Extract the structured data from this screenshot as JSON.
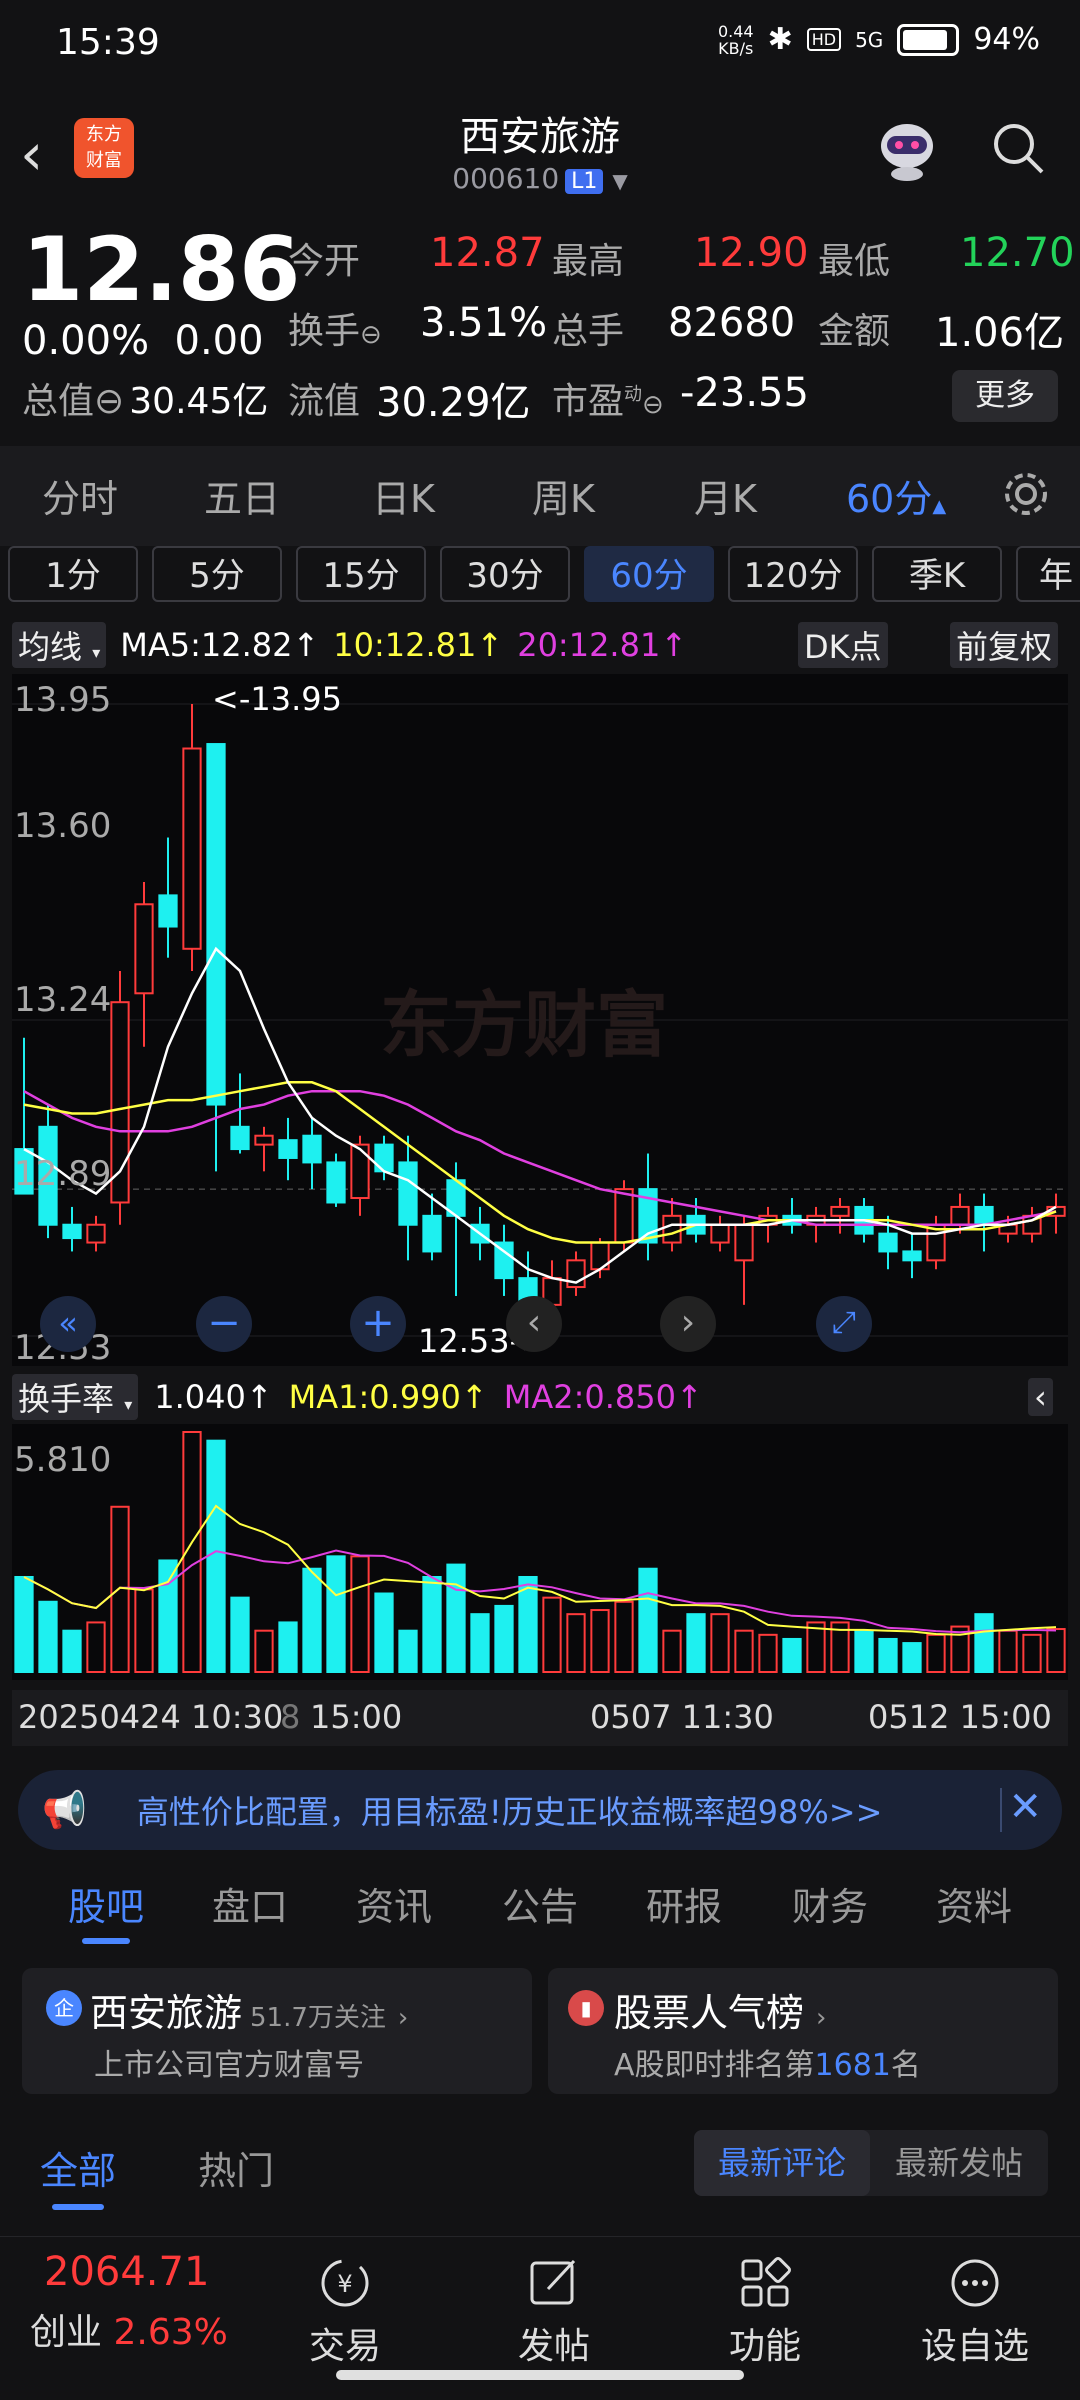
{
  "status_bar": {
    "time": "15:39",
    "net_speed_top": "0.44",
    "net_speed_unit": "KB/s",
    "hd": "HD",
    "net": "5G",
    "battery": "94%"
  },
  "header": {
    "logo_line1": "东方",
    "logo_line2": "财富",
    "stock_name": "西安旅游",
    "stock_code": "000610",
    "level": "L1"
  },
  "quote": {
    "price": "12.86",
    "change_pct": "0.00%",
    "change": "0.00",
    "open_label": "今开",
    "open": "12.87",
    "high_label": "最高",
    "high": "12.90",
    "low_label": "最低",
    "low": "12.70",
    "turnover_label": "换手",
    "turnover": "3.51%",
    "volume_label": "总手",
    "volume": "82680",
    "amount_label": "金额",
    "amount": "1.06亿",
    "mktcap_label": "总值",
    "mktcap": "30.45亿",
    "float_label": "流值",
    "float_cap": "30.29亿",
    "pe_label": "市盈",
    "pe_sup": "动",
    "pe": "-23.55",
    "more": "更多"
  },
  "period_tabs": [
    "分时",
    "五日",
    "日K",
    "周K",
    "月K",
    "60分"
  ],
  "sub_periods": [
    "1分",
    "5分",
    "15分",
    "30分",
    "60分",
    "120分",
    "季K",
    "年"
  ],
  "ma_bar": {
    "label": "均线",
    "ma5": "MA5:12.82↑",
    "ma10": "10:12.81↑",
    "ma20": "20:12.81↑",
    "dk": "DK点",
    "fq": "前复权"
  },
  "price_axis": [
    "13.95",
    "13.60",
    "13.24",
    "12.89",
    "12.53"
  ],
  "annotations": {
    "high": "<-13.95",
    "low": "12.53->",
    "watermark": "东方财富"
  },
  "ind_bar": {
    "label": "换手率",
    "v": "1.040↑",
    "ma1": "MA1:0.990↑",
    "ma2": "MA2:0.850↑",
    "axis_max": "5.810"
  },
  "time_axis": [
    "20250424 10:30",
    "8",
    "15:00",
    "0507 11:30",
    "0512 15:00"
  ],
  "colors": {
    "up": "#ff3b3b",
    "down": "#1ef0f0",
    "ma5": "#ffffff",
    "ma10": "#ffff44",
    "ma20": "#e040e0",
    "accent": "#4a86ff"
  },
  "chart_data": {
    "type": "candlestick",
    "ylim": [
      12.53,
      13.95
    ],
    "candles": [
      {
        "o": 12.95,
        "h": 13.2,
        "l": 12.85,
        "c": 12.85
      },
      {
        "o": 13.0,
        "h": 13.05,
        "l": 12.75,
        "c": 12.78
      },
      {
        "o": 12.78,
        "h": 12.82,
        "l": 12.72,
        "c": 12.75
      },
      {
        "o": 12.74,
        "h": 12.8,
        "l": 12.72,
        "c": 12.78
      },
      {
        "o": 12.83,
        "h": 13.35,
        "l": 12.78,
        "c": 13.28
      },
      {
        "o": 13.3,
        "h": 13.55,
        "l": 13.18,
        "c": 13.5
      },
      {
        "o": 13.52,
        "h": 13.65,
        "l": 13.38,
        "c": 13.45
      },
      {
        "o": 13.4,
        "h": 13.95,
        "l": 13.35,
        "c": 13.85
      },
      {
        "o": 13.86,
        "h": 13.86,
        "l": 12.9,
        "c": 13.05
      },
      {
        "o": 13.0,
        "h": 13.12,
        "l": 12.94,
        "c": 12.95
      },
      {
        "o": 12.96,
        "h": 13.0,
        "l": 12.9,
        "c": 12.98
      },
      {
        "o": 12.97,
        "h": 13.02,
        "l": 12.88,
        "c": 12.93
      },
      {
        "o": 12.98,
        "h": 13.02,
        "l": 12.86,
        "c": 12.92
      },
      {
        "o": 12.92,
        "h": 12.94,
        "l": 12.82,
        "c": 12.83
      },
      {
        "o": 12.84,
        "h": 12.98,
        "l": 12.8,
        "c": 12.96
      },
      {
        "o": 12.96,
        "h": 12.98,
        "l": 12.88,
        "c": 12.9
      },
      {
        "o": 12.92,
        "h": 12.98,
        "l": 12.7,
        "c": 12.78
      },
      {
        "o": 12.8,
        "h": 12.85,
        "l": 12.7,
        "c": 12.72
      },
      {
        "o": 12.88,
        "h": 12.92,
        "l": 12.62,
        "c": 12.8
      },
      {
        "o": 12.78,
        "h": 12.82,
        "l": 12.7,
        "c": 12.74
      },
      {
        "o": 12.74,
        "h": 12.78,
        "l": 12.62,
        "c": 12.66
      },
      {
        "o": 12.66,
        "h": 12.72,
        "l": 12.53,
        "c": 12.6
      },
      {
        "o": 12.6,
        "h": 12.7,
        "l": 12.58,
        "c": 12.66
      },
      {
        "o": 12.64,
        "h": 12.72,
        "l": 12.62,
        "c": 12.7
      },
      {
        "o": 12.68,
        "h": 12.75,
        "l": 12.66,
        "c": 12.74
      },
      {
        "o": 12.74,
        "h": 12.88,
        "l": 12.72,
        "c": 12.86
      },
      {
        "o": 12.86,
        "h": 12.94,
        "l": 12.7,
        "c": 12.74
      },
      {
        "o": 12.74,
        "h": 12.84,
        "l": 12.72,
        "c": 12.8
      },
      {
        "o": 12.8,
        "h": 12.84,
        "l": 12.74,
        "c": 12.76
      },
      {
        "o": 12.74,
        "h": 12.8,
        "l": 12.72,
        "c": 12.78
      },
      {
        "o": 12.7,
        "h": 12.8,
        "l": 12.6,
        "c": 12.78
      },
      {
        "o": 12.78,
        "h": 12.82,
        "l": 12.74,
        "c": 12.8
      },
      {
        "o": 12.8,
        "h": 12.84,
        "l": 12.76,
        "c": 12.78
      },
      {
        "o": 12.78,
        "h": 12.82,
        "l": 12.74,
        "c": 12.8
      },
      {
        "o": 12.8,
        "h": 12.84,
        "l": 12.76,
        "c": 12.82
      },
      {
        "o": 12.82,
        "h": 12.84,
        "l": 12.74,
        "c": 12.76
      },
      {
        "o": 12.76,
        "h": 12.8,
        "l": 12.68,
        "c": 12.72
      },
      {
        "o": 12.72,
        "h": 12.76,
        "l": 12.66,
        "c": 12.7
      },
      {
        "o": 12.7,
        "h": 12.8,
        "l": 12.68,
        "c": 12.78
      },
      {
        "o": 12.78,
        "h": 12.85,
        "l": 12.76,
        "c": 12.82
      },
      {
        "o": 12.82,
        "h": 12.85,
        "l": 12.72,
        "c": 12.78
      },
      {
        "o": 12.76,
        "h": 12.8,
        "l": 12.74,
        "c": 12.78
      },
      {
        "o": 12.76,
        "h": 12.82,
        "l": 12.74,
        "c": 12.8
      },
      {
        "o": 12.8,
        "h": 12.85,
        "l": 12.76,
        "c": 12.82
      }
    ],
    "ma5": [
      12.95,
      12.92,
      12.88,
      12.85,
      12.9,
      13.0,
      13.18,
      13.3,
      13.4,
      13.35,
      13.22,
      13.1,
      13.02,
      12.98,
      12.95,
      12.9,
      12.88,
      12.84,
      12.8,
      12.76,
      12.72,
      12.68,
      12.66,
      12.65,
      12.68,
      12.72,
      12.76,
      12.78,
      12.78,
      12.78,
      12.78,
      12.78,
      12.79,
      12.79,
      12.79,
      12.79,
      12.78,
      12.76,
      12.76,
      12.77,
      12.78,
      12.78,
      12.79,
      12.82
    ],
    "ma10": [
      13.05,
      13.04,
      13.03,
      13.03,
      13.04,
      13.05,
      13.06,
      13.06,
      13.07,
      13.08,
      13.09,
      13.1,
      13.1,
      13.08,
      13.04,
      13.0,
      12.96,
      12.92,
      12.88,
      12.84,
      12.8,
      12.77,
      12.75,
      12.74,
      12.74,
      12.74,
      12.75,
      12.76,
      12.78,
      12.78,
      12.78,
      12.79,
      12.79,
      12.79,
      12.79,
      12.79,
      12.79,
      12.78,
      12.77,
      12.77,
      12.77,
      12.78,
      12.79,
      12.81
    ],
    "ma20": [
      13.08,
      13.05,
      13.02,
      13.0,
      12.99,
      12.99,
      12.99,
      13.0,
      13.02,
      13.04,
      13.05,
      13.07,
      13.08,
      13.08,
      13.08,
      13.07,
      13.05,
      13.02,
      12.99,
      12.97,
      12.94,
      12.92,
      12.9,
      12.88,
      12.86,
      12.85,
      12.84,
      12.83,
      12.82,
      12.81,
      12.8,
      12.79,
      12.79,
      12.78,
      12.78,
      12.78,
      12.78,
      12.78,
      12.78,
      12.78,
      12.78,
      12.79,
      12.8,
      12.81
    ],
    "turnover": [
      2.3,
      1.7,
      1.0,
      1.2,
      4.0,
      2.0,
      2.7,
      5.81,
      5.6,
      1.8,
      1.0,
      1.2,
      2.5,
      2.8,
      2.8,
      1.9,
      1.0,
      2.3,
      2.6,
      1.4,
      1.6,
      2.3,
      1.8,
      1.4,
      1.5,
      1.7,
      2.5,
      1.0,
      1.4,
      1.4,
      1.0,
      0.9,
      0.8,
      1.2,
      1.2,
      1.0,
      0.8,
      0.7,
      0.9,
      1.1,
      1.4,
      1.0,
      0.9,
      1.04
    ],
    "turnover_ylim": [
      0,
      5.81
    ]
  },
  "ad_banner": {
    "text": "高性价比配置，用目标盈!历史正收益概率超98%>>"
  },
  "content_tabs": [
    "股吧",
    "盘口",
    "资讯",
    "公告",
    "研报",
    "财务",
    "资料"
  ],
  "card_left": {
    "title": "西安旅游",
    "follow": "51.7万关注",
    "sub": "上市公司官方财富号"
  },
  "card_right": {
    "title": "股票人气榜",
    "sub_prefix": "A股即时排名第",
    "rank": "1681",
    "sub_suffix": "名"
  },
  "feed_tabs": {
    "all": "全部",
    "hot": "热门",
    "latest_comment": "最新评论",
    "latest_post": "最新发帖"
  },
  "bottom_nav": {
    "index_value": "2064.71",
    "index_name": "创业",
    "index_change": "2.63%",
    "trade": "交易",
    "post": "发帖",
    "func": "功能",
    "watch": "设自选"
  }
}
